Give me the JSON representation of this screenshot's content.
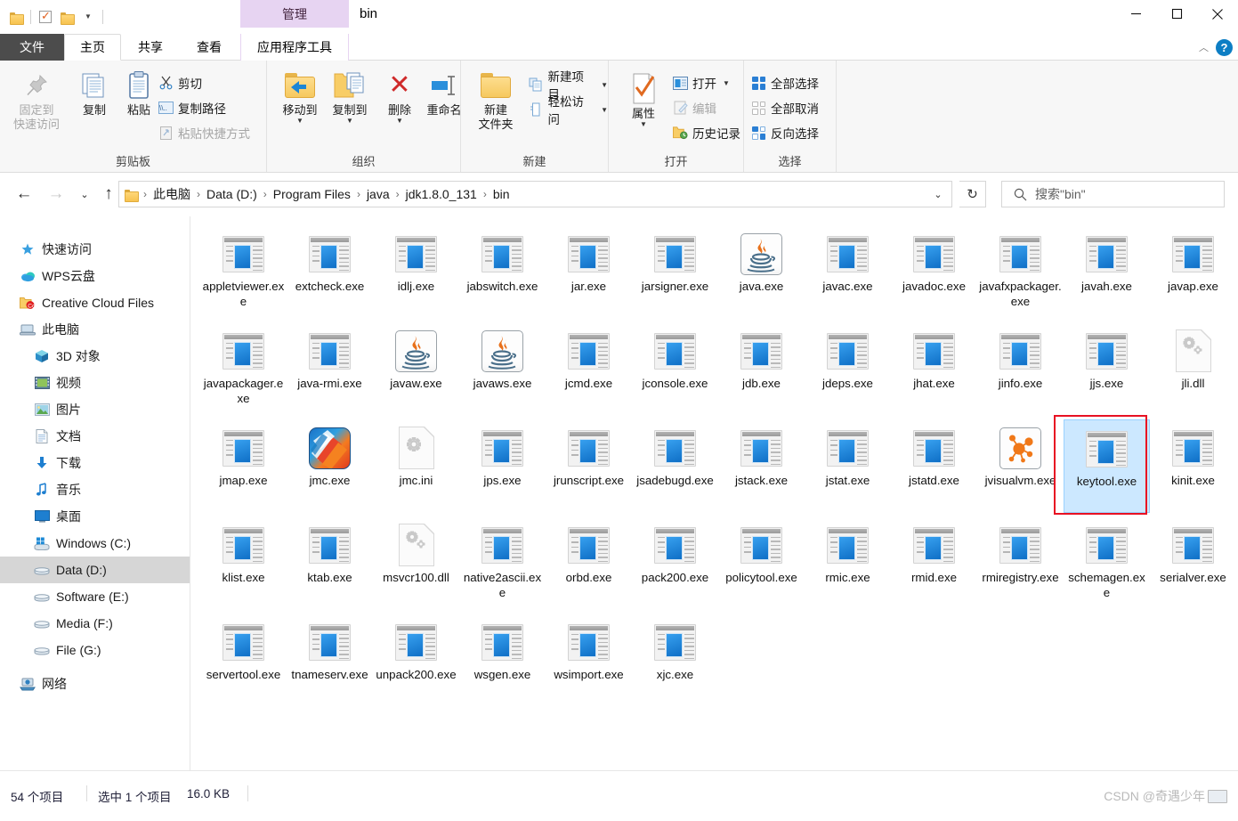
{
  "window": {
    "title": "bin",
    "contextual_tab": "管理",
    "minimize": "—",
    "maximize": "□",
    "close": "✕"
  },
  "quick_access_toolbar": {
    "items": [
      "folder-icon",
      "properties-checkbox-icon",
      "new-folder-icon"
    ],
    "dropdown_caret": "▾"
  },
  "tabs": {
    "file": "文件",
    "items": [
      "主页",
      "共享",
      "查看",
      "应用程序工具"
    ],
    "selected": "主页",
    "contextual": "应用程序工具"
  },
  "ribbon": {
    "collapse_caret": "︿",
    "help": "?",
    "groups": [
      {
        "label": "剪贴板",
        "big_buttons": [
          {
            "label_line1": "固定到",
            "label_line2": "快速访问",
            "icon": "pin-icon",
            "disabled": true
          },
          {
            "label_line1": "复制",
            "label_line2": "",
            "icon": "copy-icon",
            "disabled": false
          },
          {
            "label_line1": "粘贴",
            "label_line2": "",
            "icon": "paste-icon",
            "disabled": false
          }
        ],
        "small_buttons": [
          {
            "label": "剪切",
            "icon": "scissors-icon",
            "disabled": false
          },
          {
            "label": "复制路径",
            "icon": "copy-path-icon",
            "disabled": false
          },
          {
            "label": "粘贴快捷方式",
            "icon": "paste-shortcut-icon",
            "disabled": true
          }
        ]
      },
      {
        "label": "组织",
        "big_buttons": [
          {
            "label_line1": "移动到",
            "label_line2": "",
            "icon": "move-to-icon",
            "caret": "▾"
          },
          {
            "label_line1": "复制到",
            "label_line2": "",
            "icon": "copy-to-icon",
            "caret": "▾"
          },
          {
            "label_line1": "删除",
            "label_line2": "",
            "icon": "delete-icon",
            "caret": "▾"
          },
          {
            "label_line1": "重命名",
            "label_line2": "",
            "icon": "rename-icon",
            "caret": ""
          }
        ]
      },
      {
        "label": "新建",
        "big_buttons": [
          {
            "label_line1": "新建",
            "label_line2": "文件夹",
            "icon": "new-folder-icon"
          }
        ],
        "small_buttons": [
          {
            "label": "新建项目",
            "icon": "new-item-icon",
            "caret": "▾"
          },
          {
            "label": "轻松访问",
            "icon": "easy-access-icon",
            "caret": "▾"
          }
        ]
      },
      {
        "label": "打开",
        "big_buttons": [
          {
            "label_line1": "属性",
            "label_line2": "",
            "icon": "properties-icon",
            "caret": "▾"
          }
        ],
        "small_buttons": [
          {
            "label": "打开",
            "icon": "open-icon",
            "caret": "▾",
            "disabled": false
          },
          {
            "label": "编辑",
            "icon": "edit-icon",
            "disabled": true
          },
          {
            "label": "历史记录",
            "icon": "history-icon",
            "disabled": false
          }
        ]
      },
      {
        "label": "选择",
        "small_buttons": [
          {
            "label": "全部选择",
            "icon": "select-all-icon"
          },
          {
            "label": "全部取消",
            "icon": "select-none-icon"
          },
          {
            "label": "反向选择",
            "icon": "invert-selection-icon"
          }
        ]
      }
    ]
  },
  "address_bar": {
    "back": "←",
    "forward": "→",
    "recent": "⌄",
    "up": "↑",
    "crumbs": [
      "此电脑",
      "Data (D:)",
      "Program Files",
      "java",
      "jdk1.8.0_131",
      "bin"
    ],
    "separator": "›",
    "dropdown": "⌄",
    "refresh": "↻"
  },
  "search": {
    "placeholder": "搜索\"bin\"",
    "icon": "search-icon"
  },
  "sidebar": {
    "items": [
      {
        "label": "快速访问",
        "icon": "star-icon",
        "indent": false,
        "selected": false
      },
      {
        "label": "WPS云盘",
        "icon": "cloud-icon",
        "indent": false,
        "selected": false
      },
      {
        "label": "Creative Cloud Files",
        "icon": "creative-cloud-icon",
        "indent": false,
        "selected": false
      },
      {
        "label": "此电脑",
        "icon": "this-pc-icon",
        "indent": false,
        "selected": false
      },
      {
        "label": "3D 对象",
        "icon": "3d-objects-icon",
        "indent": true,
        "selected": false
      },
      {
        "label": "视频",
        "icon": "videos-icon",
        "indent": true,
        "selected": false
      },
      {
        "label": "图片",
        "icon": "pictures-icon",
        "indent": true,
        "selected": false
      },
      {
        "label": "文档",
        "icon": "documents-icon",
        "indent": true,
        "selected": false
      },
      {
        "label": "下载",
        "icon": "downloads-icon",
        "indent": true,
        "selected": false
      },
      {
        "label": "音乐",
        "icon": "music-icon",
        "indent": true,
        "selected": false
      },
      {
        "label": "桌面",
        "icon": "desktop-icon",
        "indent": true,
        "selected": false
      },
      {
        "label": "Windows (C:)",
        "icon": "windows-drive-icon",
        "indent": true,
        "selected": false
      },
      {
        "label": "Data (D:)",
        "icon": "drive-icon",
        "indent": true,
        "selected": true
      },
      {
        "label": "Software (E:)",
        "icon": "drive-icon",
        "indent": true,
        "selected": false
      },
      {
        "label": "Media (F:)",
        "icon": "drive-icon",
        "indent": true,
        "selected": false
      },
      {
        "label": "File (G:)",
        "icon": "drive-icon",
        "indent": true,
        "selected": false
      },
      {
        "label": "网络",
        "icon": "network-icon",
        "indent": false,
        "selected": false
      }
    ]
  },
  "files": [
    {
      "name": "appletviewer.exe",
      "icon": "exe"
    },
    {
      "name": "extcheck.exe",
      "icon": "exe"
    },
    {
      "name": "idlj.exe",
      "icon": "exe"
    },
    {
      "name": "jabswitch.exe",
      "icon": "exe"
    },
    {
      "name": "jar.exe",
      "icon": "exe"
    },
    {
      "name": "jarsigner.exe",
      "icon": "exe"
    },
    {
      "name": "java.exe",
      "icon": "java"
    },
    {
      "name": "javac.exe",
      "icon": "exe"
    },
    {
      "name": "javadoc.exe",
      "icon": "exe"
    },
    {
      "name": "javafxpackager.exe",
      "icon": "exe"
    },
    {
      "name": "javah.exe",
      "icon": "exe"
    },
    {
      "name": "javap.exe",
      "icon": "exe"
    },
    {
      "name": "javapackager.exe",
      "icon": "exe"
    },
    {
      "name": "java-rmi.exe",
      "icon": "exe"
    },
    {
      "name": "javaw.exe",
      "icon": "java"
    },
    {
      "name": "javaws.exe",
      "icon": "java"
    },
    {
      "name": "jcmd.exe",
      "icon": "exe"
    },
    {
      "name": "jconsole.exe",
      "icon": "exe"
    },
    {
      "name": "jdb.exe",
      "icon": "exe"
    },
    {
      "name": "jdeps.exe",
      "icon": "exe"
    },
    {
      "name": "jhat.exe",
      "icon": "exe"
    },
    {
      "name": "jinfo.exe",
      "icon": "exe"
    },
    {
      "name": "jjs.exe",
      "icon": "exe"
    },
    {
      "name": "jli.dll",
      "icon": "dll"
    },
    {
      "name": "jmap.exe",
      "icon": "exe"
    },
    {
      "name": "jmc.exe",
      "icon": "jmc"
    },
    {
      "name": "jmc.ini",
      "icon": "ini"
    },
    {
      "name": "jps.exe",
      "icon": "exe"
    },
    {
      "name": "jrunscript.exe",
      "icon": "exe"
    },
    {
      "name": "jsadebugd.exe",
      "icon": "exe"
    },
    {
      "name": "jstack.exe",
      "icon": "exe"
    },
    {
      "name": "jstat.exe",
      "icon": "exe"
    },
    {
      "name": "jstatd.exe",
      "icon": "exe"
    },
    {
      "name": "jvisualvm.exe",
      "icon": "jvisualvm"
    },
    {
      "name": "keytool.exe",
      "icon": "exe",
      "selected": true
    },
    {
      "name": "kinit.exe",
      "icon": "exe"
    },
    {
      "name": "klist.exe",
      "icon": "exe"
    },
    {
      "name": "ktab.exe",
      "icon": "exe"
    },
    {
      "name": "msvcr100.dll",
      "icon": "dll"
    },
    {
      "name": "native2ascii.exe",
      "icon": "exe"
    },
    {
      "name": "orbd.exe",
      "icon": "exe"
    },
    {
      "name": "pack200.exe",
      "icon": "exe"
    },
    {
      "name": "policytool.exe",
      "icon": "exe"
    },
    {
      "name": "rmic.exe",
      "icon": "exe"
    },
    {
      "name": "rmid.exe",
      "icon": "exe"
    },
    {
      "name": "rmiregistry.exe",
      "icon": "exe"
    },
    {
      "name": "schemagen.exe",
      "icon": "exe"
    },
    {
      "name": "serialver.exe",
      "icon": "exe"
    },
    {
      "name": "servertool.exe",
      "icon": "exe"
    },
    {
      "name": "tnameserv.exe",
      "icon": "exe"
    },
    {
      "name": "unpack200.exe",
      "icon": "exe"
    },
    {
      "name": "wsgen.exe",
      "icon": "exe"
    },
    {
      "name": "wsimport.exe",
      "icon": "exe"
    },
    {
      "name": "xjc.exe",
      "icon": "exe"
    }
  ],
  "status_bar": {
    "item_count": "54 个项目",
    "selection": "选中 1 个项目",
    "size": "16.0 KB"
  },
  "watermark": {
    "text": "CSDN @奇遇少年"
  },
  "colors": {
    "selection_fill": "#cce8ff",
    "selection_border": "#99d1ff",
    "annotation_red": "#e81123",
    "contextual_tab": "#e7d4f2",
    "file_tab": "#4c4c4c",
    "help_blue": "#0d7ec4",
    "sidebar_selected": "#d6d6d6",
    "ribbon_bg": "#f7f7f7"
  }
}
